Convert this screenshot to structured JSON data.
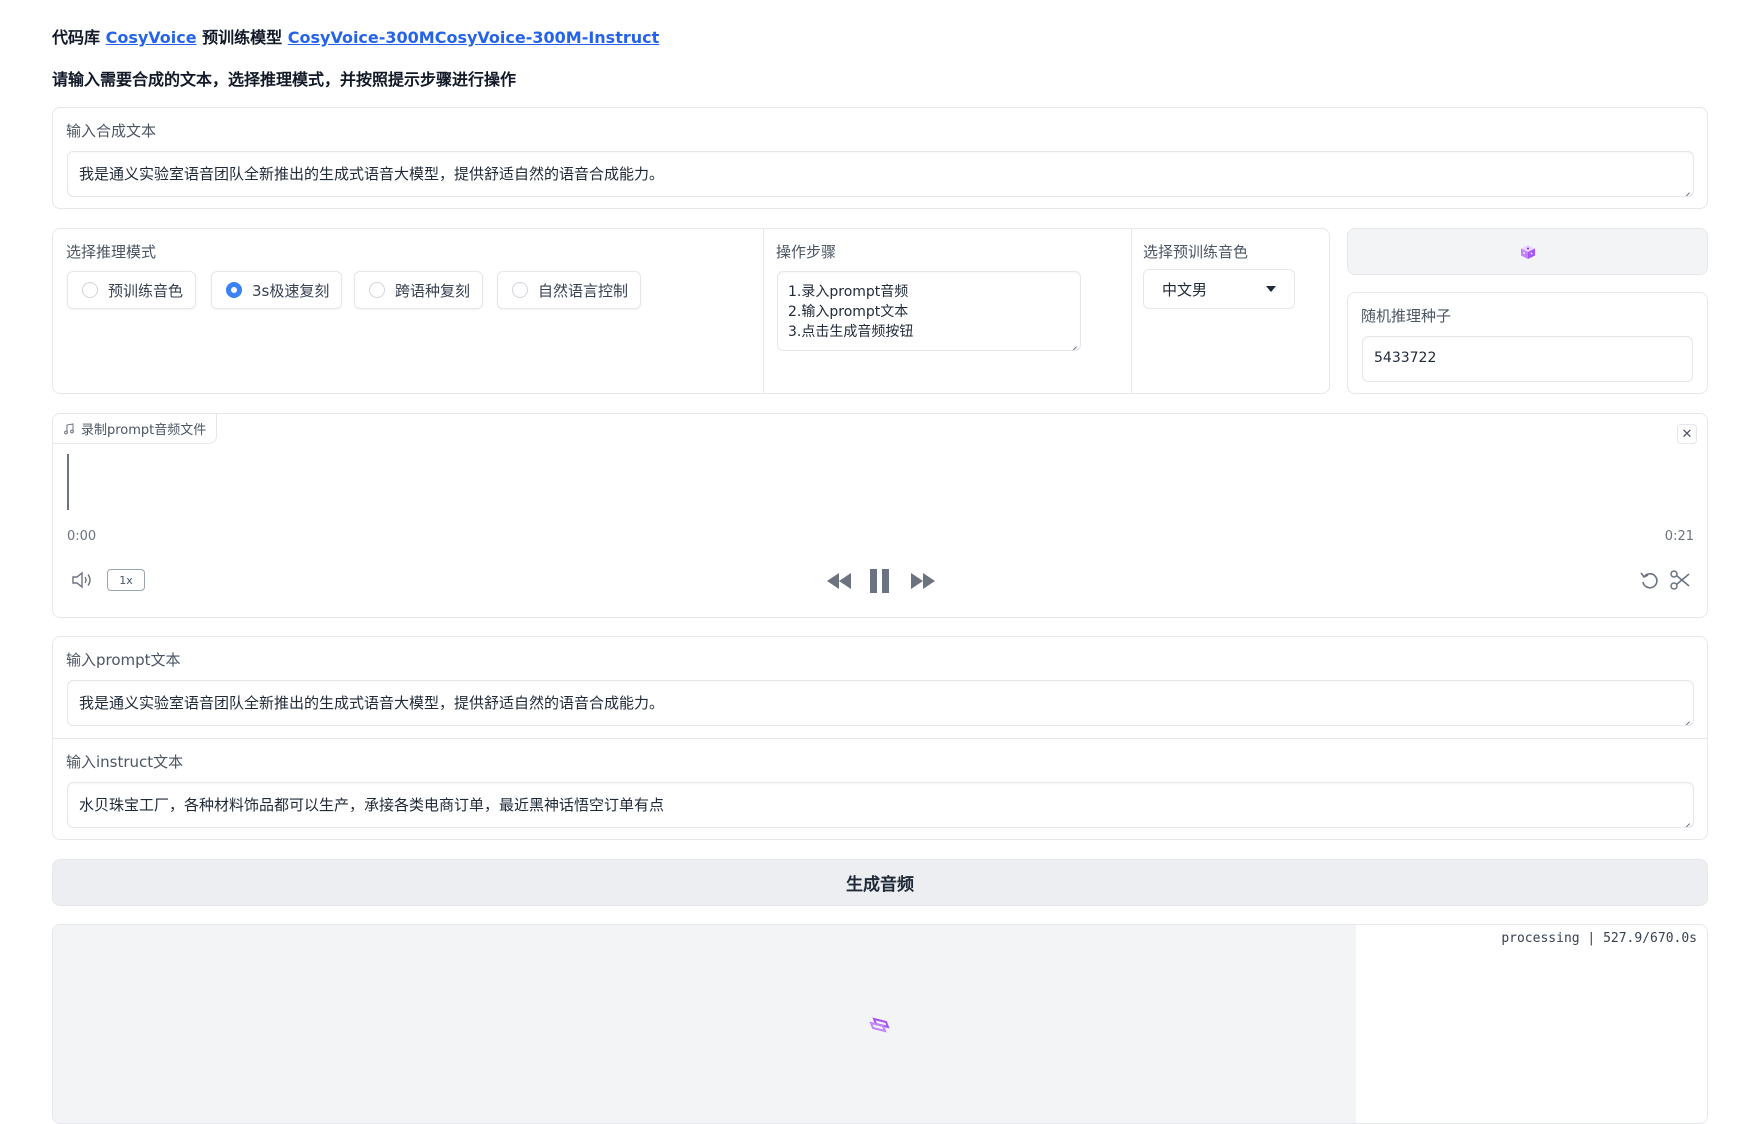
{
  "header": {
    "prefix1": "代码库 ",
    "repo_link": "CosyVoice",
    "prefix2": " 预训练模型 ",
    "model_link_1": "CosyVoice-300M",
    "model_link_2": "CosyVoice-300M-Instruct",
    "instruction": "请输入需要合成的文本，选择推理模式，并按照提示步骤进行操作"
  },
  "tts_text": {
    "label": "输入合成文本",
    "value": "我是通义实验室语音团队全新推出的生成式语音大模型，提供舒适自然的语音合成能力。"
  },
  "mode": {
    "label": "选择推理模式",
    "options": [
      "预训练音色",
      "3s极速复刻",
      "跨语种复刻",
      "自然语言控制"
    ],
    "selected": "3s极速复刻"
  },
  "steps": {
    "label": "操作步骤",
    "lines": [
      "1.录入prompt音频",
      "2.输入prompt文本",
      "3.点击生成音频按钮"
    ]
  },
  "voice": {
    "label": "选择预训练音色",
    "selected": "中文男"
  },
  "seed": {
    "dice_icon": "dice-icon",
    "label": "随机推理种子",
    "value": "5433722"
  },
  "audio": {
    "tag_label": "录制prompt音频文件",
    "current_time": "0:00",
    "duration": "0:21",
    "speed": "1x",
    "close_glyph": "✕"
  },
  "prompt_text": {
    "label": "输入prompt文本",
    "value": "我是通义实验室语音团队全新推出的生成式语音大模型，提供舒适自然的语音合成能力。"
  },
  "instruct_text": {
    "label": "输入instruct文本",
    "value": "水贝珠宝工厂，各种材料饰品都可以生产，承接各类电商订单，最近黑神话悟空订单有点"
  },
  "generate": {
    "label": "生成音频"
  },
  "output": {
    "status": "processing | 527.9/670.0s",
    "progress": 0.788
  }
}
